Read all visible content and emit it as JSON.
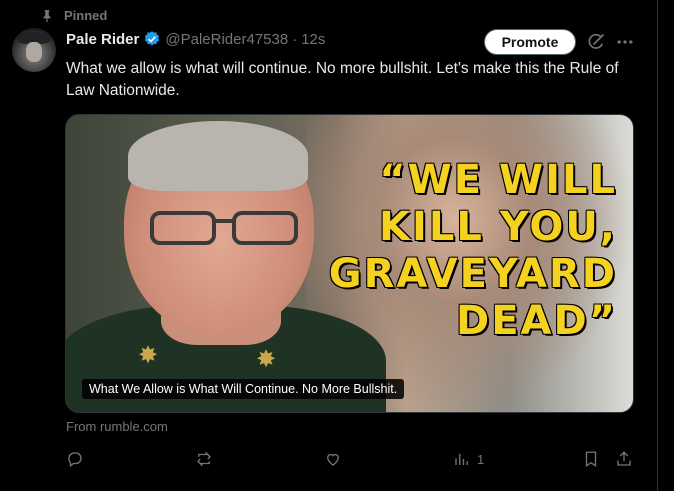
{
  "pinned": {
    "label": "Pinned"
  },
  "author": {
    "display_name": "Pale Rider",
    "handle": "@PaleRider47538",
    "separator": "·",
    "time": "12s"
  },
  "buttons": {
    "promote": "Promote"
  },
  "tweet": {
    "text": "What we allow is what will continue. No more bullshit. Let's make this the Rule of Law Nationwide."
  },
  "media": {
    "headline_lines": [
      "“WE WILL",
      "KILL YOU,",
      "GRAVEYARD",
      "DEAD”"
    ],
    "caption": "What We Allow is What Will Continue. No More Bullshit.",
    "headline_color": "#f4d21f"
  },
  "source": {
    "text": "From rumble.com"
  },
  "actions": {
    "reply_count": "",
    "repost_count": "",
    "like_count": "",
    "views_count": "1"
  },
  "colors": {
    "accent": "#1d9bf0",
    "muted": "#71767b",
    "background": "#000000"
  }
}
